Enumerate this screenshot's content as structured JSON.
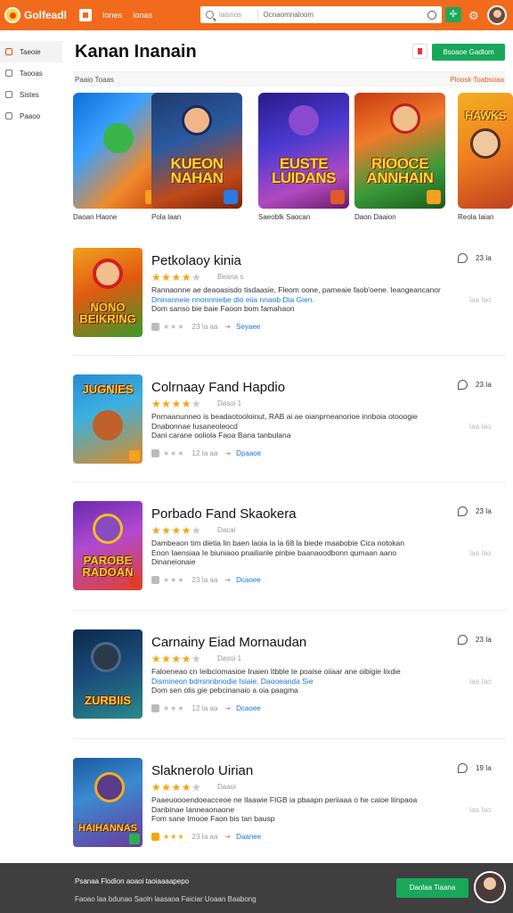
{
  "topbar": {
    "logo_text": "Golfeadl",
    "links": [
      "Iones",
      "Ionas"
    ],
    "search_category": "Iaisnos",
    "search_value": "Ocnaomnaloom",
    "grid_icon": "grid-icon",
    "settings_icon": "settings-icon"
  },
  "sidebar": {
    "items": [
      {
        "label": "Taeoie",
        "icon": "home-icon"
      },
      {
        "label": "Taooas",
        "icon": "gamepad-icon"
      },
      {
        "label": "Sistes",
        "icon": "list-icon"
      },
      {
        "label": "Paaoo",
        "icon": "clock-icon"
      }
    ]
  },
  "header": {
    "title": "Kanan Inanain",
    "primary_button": "Bsoaoe Gadlom",
    "tab_left": "Paaio Toaas",
    "tab_right": "Ploosk Toabsoaa"
  },
  "carousel": [
    {
      "art_title": "",
      "label": "Daoan Haone"
    },
    {
      "art_title": "KUEON NAHAN",
      "label": "Pola laan"
    },
    {
      "art_title": "EUSTE LUIDANS",
      "label": "Saeoblk Saocan"
    },
    {
      "art_title": "RIOOCE ANNHAIN",
      "label": "Daon Daaion"
    },
    {
      "art_title": "HAWKS",
      "label": "Reola Iaian"
    }
  ],
  "games": [
    {
      "title": "Petkolaoy kinia",
      "art_title": "NONO BEIKRING",
      "stars": 4,
      "rating_note": "Beana s",
      "desc1": "Rannaonne ae deaoasisdo tisdaasie, Fleom oone, pameaie faob'oene. leangeancanor",
      "desc2": "Dninanneie nnonnniebe dio eiia nnaob Dia Gien.",
      "desc3": "Dom sanso bie baie Faoon bom famahaon",
      "meta_count": "23 Ia aa",
      "meta_link": "Seyaee",
      "count": "23 Ia",
      "side_meta": "Iaa Iao"
    },
    {
      "title": "Colrnaay Fand Hapdio",
      "art_title": "JUGNIES",
      "stars": 4,
      "rating_note": "Dasoi 1",
      "desc1": "Pnrnaanunneo is beadaotooloinut, RAB ai ae oianprneanorioe innboia otooogie",
      "desc2": "Dnabonnae Iusaneoleocd",
      "desc3": "Dani carane ooliola Faoa Bana tanbulana",
      "meta_count": "12 Ia aa",
      "meta_link": "Dpaaoe",
      "count": "23 Ia",
      "side_meta": "Iaa Iao"
    },
    {
      "title": "Porbado Fand Skaokera",
      "art_title": "PAROBE RADOAN",
      "stars": 4,
      "rating_note": "Dacai",
      "desc1": "Dambeaon tim dietia lin baen laoia la la 68 la biede maabobie Cica notokan",
      "desc2": "Enon Iaensiaa Ie biuniaoo pnailianle pinbie baanaoodbonn qumaan aano",
      "desc3": "Dinaneionaie",
      "meta_count": "23 Ia aa",
      "meta_link": "Dcaoee",
      "count": "23 Ia",
      "side_meta": "Iaa Iao"
    },
    {
      "title": "Carnainy Eiad Mornaudan",
      "art_title": "ZURBIIS",
      "stars": 4,
      "rating_note": "Dasoi 1",
      "desc1": "Faloeneao cn Ieibciomasioe Inaien Itbble te poaise oiiaar ane oibigie lixdie",
      "desc2": "Dismineon bdminnbnodie Isiaie. Daooeanda Sie",
      "desc3": "Dom sen olis gie pebcinanaio a oia paagma",
      "meta_count": "12 Ia aa",
      "meta_link": "Dcaoee",
      "count": "23 Ia",
      "side_meta": "Iaa Iao"
    },
    {
      "title": "Slaknerolo Uirian",
      "art_title": "HAIHANNAS",
      "stars": 4,
      "rating_note": "Daaoi",
      "desc1": "Paaeuoooendoeacceoe ne Ilaawie FIGB ia pbaapn periiaaa o he caioe liinpaoa",
      "desc2": "Danbinae Ianneaonaone",
      "desc3": "Fom sane Imooe Faon bis tan bausp",
      "meta_count": "23 Ia aa",
      "meta_link": "Daanee",
      "count": "19 Ia",
      "side_meta": "Iaa Iao"
    }
  ],
  "bottombar": {
    "line1": "Psanaa Flodion aoaoi taoiaaaapepo",
    "line2": "Faoao laa bdunao Saoln laasaoa Faiciar Uoaan Baabong",
    "button": "Daolaa Tiaana"
  },
  "colors": {
    "brand": "#f26a1b",
    "accent": "#18a85a",
    "star": "#f6a60f",
    "link": "#1976d2"
  }
}
